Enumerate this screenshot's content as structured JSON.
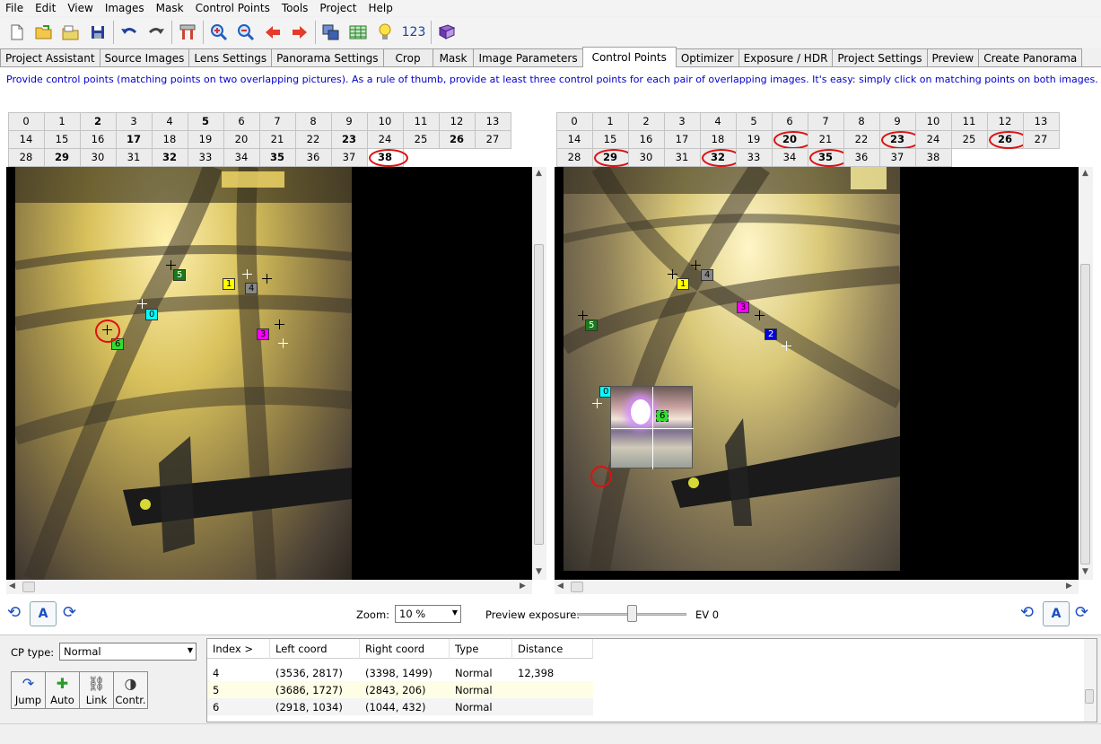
{
  "menu": [
    "File",
    "Edit",
    "View",
    "Images",
    "Mask",
    "Control Points",
    "Tools",
    "Project",
    "Help"
  ],
  "toolbar": {
    "icons": [
      "new-file-icon",
      "open-folder-icon",
      "open-recent-icon",
      "save-icon",
      "undo-icon",
      "redo-icon",
      "assistant-tools-icon",
      "zoom-in-icon",
      "zoom-out-icon",
      "previous-icon",
      "next-icon",
      "stitch-icon",
      "table-icon",
      "tip-bulb-icon",
      "numbers-icon",
      "help-book-icon"
    ],
    "numbers_label": "123"
  },
  "tabs": [
    "Project Assistant",
    "Source Images",
    "Lens Settings",
    "Panorama Settings",
    "Crop",
    "Mask",
    "Image Parameters",
    "Control Points",
    "Optimizer",
    "Exposure / HDR",
    "Project Settings",
    "Preview",
    "Create Panorama"
  ],
  "active_tab": "Control Points",
  "info_text": "Provide control points (matching points on two overlapping pictures). As a rule of thumb, provide at least three control points for each pair of overlapping images. It's easy: simply click on matching points on both images.",
  "left_images": {
    "numbers": [
      "0",
      "1",
      "2",
      "3",
      "4",
      "5",
      "6",
      "7",
      "8",
      "9",
      "10",
      "11",
      "12",
      "13",
      "14",
      "15",
      "16",
      "17",
      "18",
      "19",
      "20",
      "21",
      "22",
      "23",
      "24",
      "25",
      "26",
      "27",
      "28",
      "29",
      "30",
      "31",
      "32",
      "33",
      "34",
      "35",
      "36",
      "37",
      "38"
    ],
    "bold": [
      "2",
      "5",
      "17",
      "23",
      "26",
      "29",
      "32",
      "35",
      "38"
    ],
    "selected": "38",
    "circled": [
      "38"
    ]
  },
  "right_images": {
    "numbers": [
      "0",
      "1",
      "2",
      "3",
      "4",
      "5",
      "6",
      "7",
      "8",
      "9",
      "10",
      "11",
      "12",
      "13",
      "14",
      "15",
      "16",
      "17",
      "18",
      "19",
      "20",
      "21",
      "22",
      "23",
      "24",
      "25",
      "26",
      "27",
      "28",
      "29",
      "30",
      "31",
      "32",
      "33",
      "34",
      "35",
      "36",
      "37",
      "38"
    ],
    "bold": [
      "20",
      "23",
      "26",
      "29",
      "32",
      "35"
    ],
    "circled": [
      "20",
      "23",
      "26",
      "29",
      "32",
      "35"
    ]
  },
  "left_cps": [
    {
      "label": "5",
      "color": "#1a7a1a"
    },
    {
      "label": "1",
      "color": "#ffff00"
    },
    {
      "label": "4",
      "color": "#888888"
    },
    {
      "label": "0",
      "color": "#00ffff"
    },
    {
      "label": "3",
      "color": "#ff00ff"
    },
    {
      "label": "6",
      "color": "#33dd33"
    }
  ],
  "right_cps": [
    {
      "label": "4",
      "color": "#888888"
    },
    {
      "label": "1",
      "color": "#ffff00"
    },
    {
      "label": "3",
      "color": "#ff00ff"
    },
    {
      "label": "2",
      "color": "#0000dd"
    },
    {
      "label": "5",
      "color": "#1a7a1a"
    },
    {
      "label": "0",
      "color": "#00ffff"
    },
    {
      "label": "6",
      "color": "#33dd33"
    }
  ],
  "controls": {
    "zoom_label": "Zoom:",
    "zoom_value": "10 %",
    "exposure_label": "Preview exposure:",
    "ev_label": "EV 0",
    "auto_rotate_label": "A",
    "exposure_slider_fraction": 0.5
  },
  "cp_panel": {
    "cp_type_label": "CP type:",
    "cp_type_value": "Normal",
    "buttons": [
      {
        "label": "Jump",
        "icon": "jump-icon"
      },
      {
        "label": "Auto",
        "icon": "auto-icon"
      },
      {
        "label": "Link",
        "icon": "link-icon"
      },
      {
        "label": "Contr.",
        "icon": "contrast-icon"
      }
    ]
  },
  "cp_table": {
    "columns": [
      "Index >",
      "Left coord",
      "Right coord",
      "Type",
      "Distance"
    ],
    "rows": [
      {
        "index": "4",
        "left": "(3536, 2817)",
        "right": "(3398, 1499)",
        "type": "Normal",
        "distance": "12,398"
      },
      {
        "index": "5",
        "left": "(3686, 1727)",
        "right": "(2843, 206)",
        "type": "Normal",
        "distance": ""
      },
      {
        "index": "6",
        "left": "(2918, 1034)",
        "right": "(1044, 432)",
        "type": "Normal",
        "distance": ""
      }
    ]
  }
}
